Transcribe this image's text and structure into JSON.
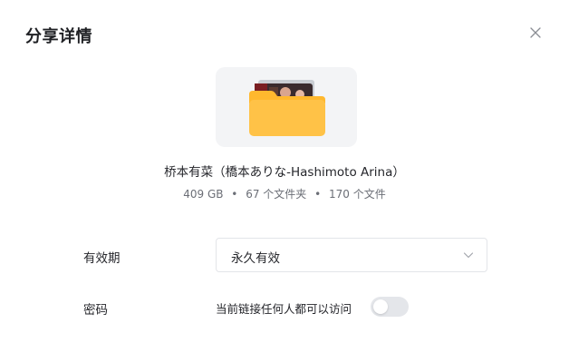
{
  "dialog": {
    "title": "分享详情",
    "close_icon": "close-icon"
  },
  "file": {
    "icon": "folder-icon",
    "name": "桥本有菜（橋本ありな-Hashimoto Arina）",
    "size": "409 GB",
    "folders": "67 个文件夹",
    "files": "170 个文件",
    "separator": "•"
  },
  "settings": {
    "validity_label": "有效期",
    "validity_value": "永久有效",
    "password_label": "密码",
    "password_desc": "当前链接任何人都可以访问",
    "password_enabled": false
  },
  "colors": {
    "folder": "#ffc247",
    "toggle_off": "#e4e6ea"
  }
}
